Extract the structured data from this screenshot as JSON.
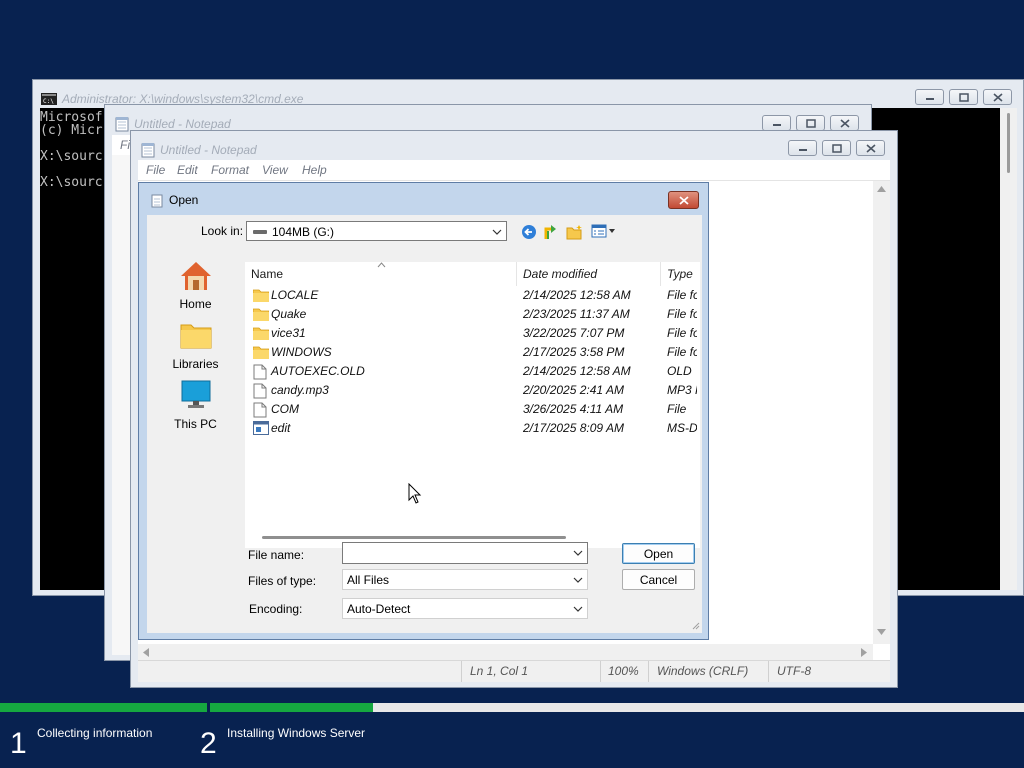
{
  "cmd": {
    "title": "Administrator: X:\\windows\\system32\\cmd.exe",
    "lines": [
      "Microsof",
      "(c) Micr",
      "",
      "X:\\sourc",
      "",
      "X:\\sourc"
    ]
  },
  "notepad_back": {
    "title": "Untitled - Notepad",
    "menu_first": "Fi"
  },
  "notepad": {
    "title": "Untitled - Notepad",
    "menu": [
      "File",
      "Edit",
      "Format",
      "View",
      "Help"
    ],
    "status": {
      "position": "Ln 1, Col 1",
      "zoom": "100%",
      "line_ending": "Windows (CRLF)",
      "encoding": "UTF-8"
    }
  },
  "open_dialog": {
    "title": "Open",
    "look_in_label": "Look in:",
    "look_in_value": "104MB (G:)",
    "places": [
      {
        "label": "Home",
        "icon": "home-icon"
      },
      {
        "label": "Libraries",
        "icon": "libraries-icon"
      },
      {
        "label": "This PC",
        "icon": "this-pc-icon"
      }
    ],
    "columns": {
      "name": "Name",
      "date": "Date modified",
      "type": "Type"
    },
    "files": [
      {
        "name": "LOCALE",
        "date": "2/14/2025 12:58 AM",
        "type": "File fo",
        "icon": "folder-icon"
      },
      {
        "name": "Quake",
        "date": "2/23/2025 11:37 AM",
        "type": "File fo",
        "icon": "folder-icon"
      },
      {
        "name": "vice31",
        "date": "3/22/2025 7:07 PM",
        "type": "File fo",
        "icon": "folder-icon"
      },
      {
        "name": "WINDOWS",
        "date": "2/17/2025 3:58 PM",
        "type": "File fo",
        "icon": "folder-icon"
      },
      {
        "name": "AUTOEXEC.OLD",
        "date": "2/14/2025 12:58 AM",
        "type": "OLD",
        "icon": "file-icon"
      },
      {
        "name": "candy.mp3",
        "date": "2/20/2025 2:41 AM",
        "type": "MP3 F",
        "icon": "file-icon"
      },
      {
        "name": "COM",
        "date": "3/26/2025 4:11 AM",
        "type": "File",
        "icon": "file-icon"
      },
      {
        "name": "edit",
        "date": "2/17/2025 8:09 AM",
        "type": "MS-D",
        "icon": "exe-icon"
      }
    ],
    "file_name_label": "File name:",
    "file_name_value": "",
    "files_of_type_label": "Files of type:",
    "files_of_type_value": "All Files",
    "encoding_label": "Encoding:",
    "encoding_value": "Auto-Detect",
    "open_button": "Open",
    "cancel_button": "Cancel"
  },
  "setup_progress": {
    "steps": [
      {
        "number": "1",
        "label": "Collecting information",
        "progress": 1.0
      },
      {
        "number": "2",
        "label": "Installing Windows Server",
        "progress": 0.2
      }
    ],
    "colors": {
      "fill": "#16a840",
      "track": "#e8e8e8",
      "background": "#082250"
    }
  }
}
